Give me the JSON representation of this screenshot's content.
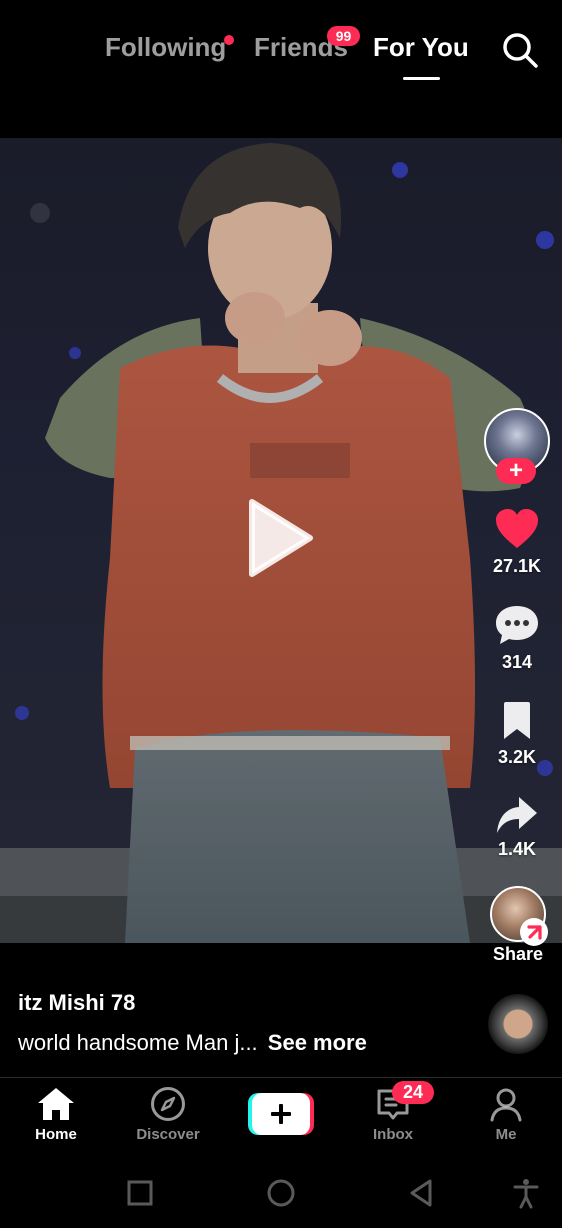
{
  "top_tabs": {
    "following": "Following",
    "friends": "Friends",
    "friends_badge": "99",
    "for_you": "For You"
  },
  "actions": {
    "likes": "27.1K",
    "comments": "314",
    "saves": "3.2K",
    "shares": "1.4K",
    "share_label": "Share"
  },
  "post": {
    "username": "itz Mishi 78",
    "caption": "world handsome Man j...",
    "see_more": "See more"
  },
  "bottom_nav": {
    "home": "Home",
    "discover": "Discover",
    "inbox": "Inbox",
    "inbox_badge": "24",
    "me": "Me"
  },
  "colors": {
    "accent": "#fe2c55",
    "create_cyan": "#25f4ee",
    "background": "#000000"
  },
  "icons": [
    "search-icon",
    "play-icon",
    "heart-icon",
    "comment-icon",
    "bookmark-icon",
    "share-icon",
    "home-icon",
    "compass-icon",
    "plus-icon",
    "inbox-icon",
    "profile-icon",
    "recents-icon",
    "home-circle-icon",
    "back-icon",
    "accessibility-icon"
  ]
}
